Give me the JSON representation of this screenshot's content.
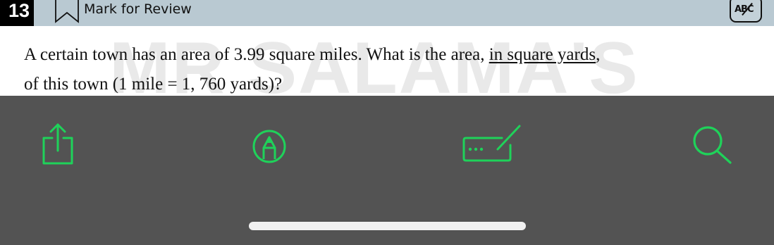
{
  "header": {
    "question_number": "13",
    "mark_label": "Mark for Review",
    "abc_label": "ABC"
  },
  "question": {
    "watermark": "MR SALAMA'S",
    "line1_prefix": "A certain town has an area of 3.99 square miles. What is the area, ",
    "line1_underlined": "in square yards",
    "line1_suffix": ",",
    "line2": "of this town (1 mile = 1, 760 yards)?"
  },
  "toolbar": {
    "accent_color": "#1fd25a",
    "icons": [
      "share-icon",
      "markup-icon",
      "text-field-icon",
      "search-icon"
    ]
  }
}
